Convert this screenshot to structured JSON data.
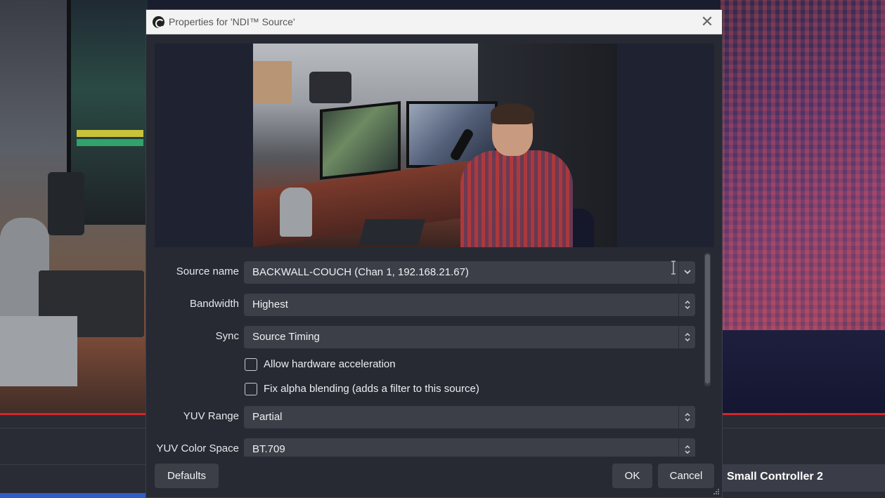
{
  "background": {
    "controller_label": "Small Controller 2"
  },
  "dialog": {
    "title": "Properties for 'NDI™ Source'",
    "close_glyph": "✕",
    "fields": {
      "source_name": {
        "label": "Source name",
        "value": "BACKWALL-COUCH (Chan 1, 192.168.21.67)"
      },
      "bandwidth": {
        "label": "Bandwidth",
        "value": "Highest"
      },
      "sync": {
        "label": "Sync",
        "value": "Source Timing"
      },
      "hw_accel": {
        "label": "Allow hardware acceleration",
        "checked": false
      },
      "fix_alpha": {
        "label": "Fix alpha blending (adds a filter to this source)",
        "checked": false
      },
      "yuv_range": {
        "label": "YUV Range",
        "value": "Partial"
      },
      "yuv_color_space": {
        "label": "YUV Color Space",
        "value": "BT.709"
      }
    },
    "buttons": {
      "defaults": "Defaults",
      "ok": "OK",
      "cancel": "Cancel"
    }
  },
  "colors": {
    "dialog_bg": "#272a33",
    "control_bg": "#3c3f48",
    "accent_red": "#d3262b"
  }
}
